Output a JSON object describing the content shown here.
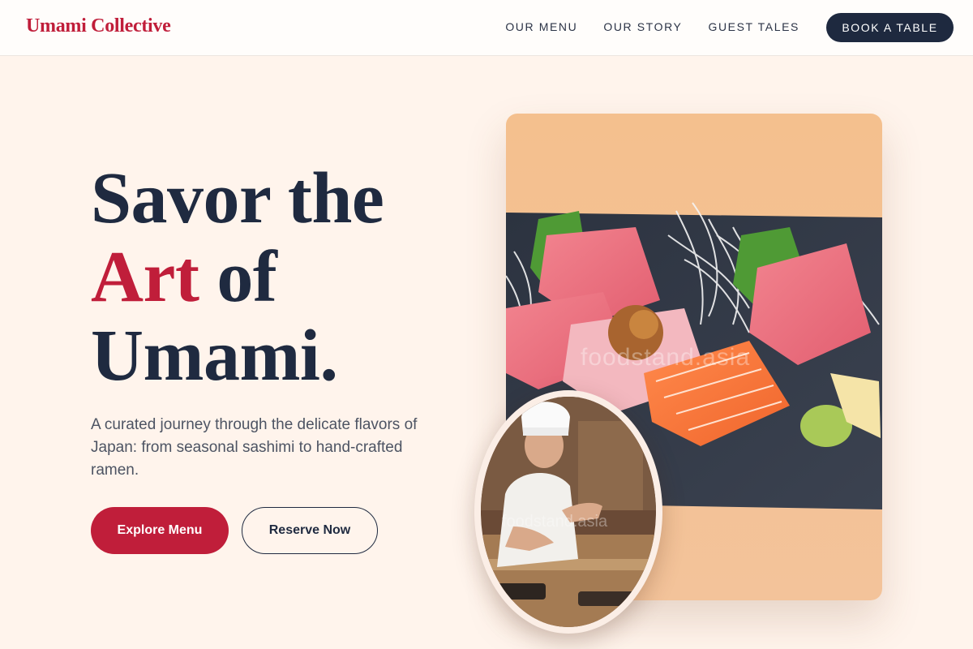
{
  "nav": {
    "logo": "Umami Collective",
    "links": [
      "OUR MENU",
      "OUR STORY",
      "GUEST TALES"
    ],
    "cta": "BOOK A TABLE"
  },
  "hero": {
    "headline_line1": "Savor the",
    "headline_accent": "Art",
    "headline_line2_rest": " of",
    "headline_line3": "Umami.",
    "subtext": "A curated journey through the delicate flavors of Japan: from seasonal sashimi to hand-crafted ramen.",
    "primary_button": "Explore Menu",
    "secondary_button": "Reserve Now"
  },
  "images": {
    "main_watermark": "foodstand.asia",
    "chef_watermark": "foodstand.asia"
  },
  "colors": {
    "accent": "#c01e3a",
    "navy": "#1e293f",
    "background": "#fff4ec"
  }
}
